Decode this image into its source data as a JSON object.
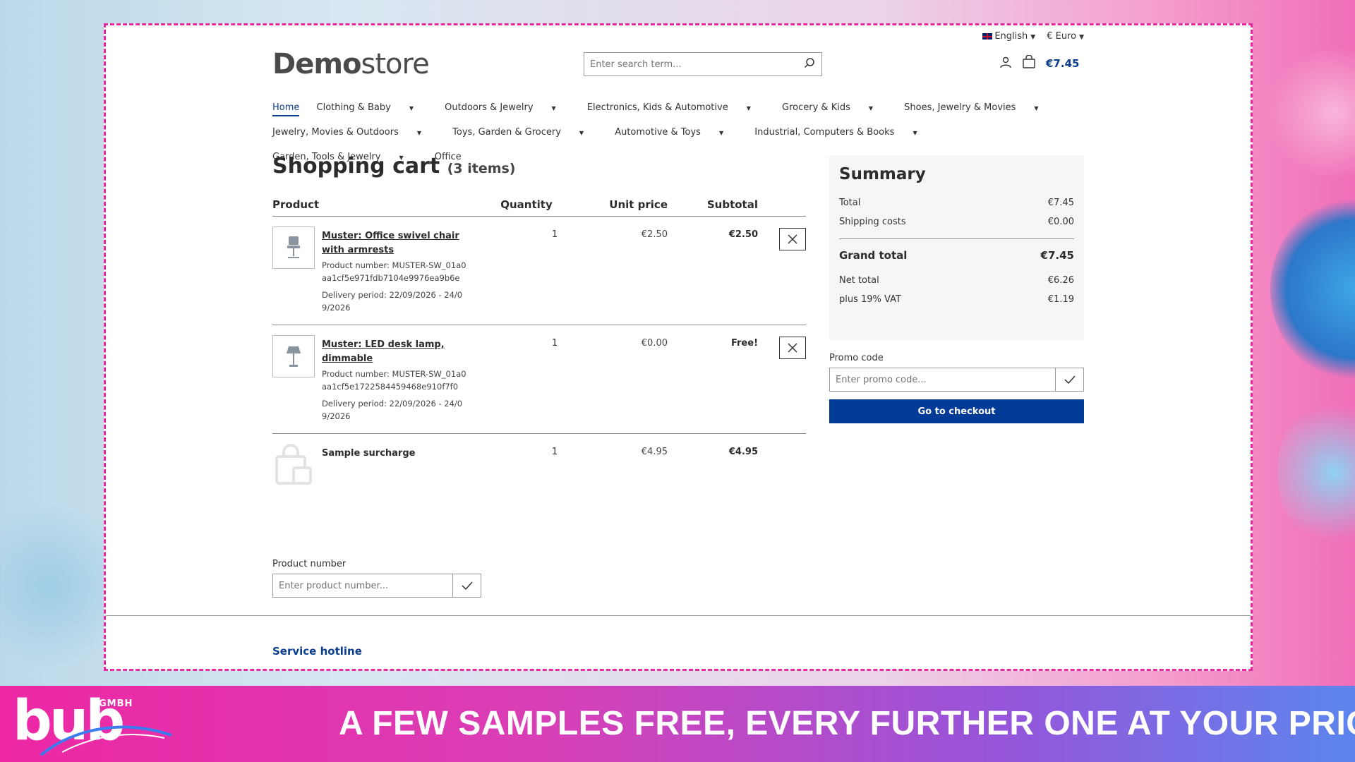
{
  "colors": {
    "accent": "#0b3d91",
    "checkout": "#003b97",
    "border_dash": "#e8289f"
  },
  "topbar": {
    "language": "English",
    "currency": "€ Euro"
  },
  "header": {
    "brand_bold": "Demo",
    "brand_light": "store",
    "search_placeholder": "Enter search term...",
    "cart_total": "€7.45"
  },
  "nav": {
    "items": [
      "Home",
      "Clothing & Baby",
      "Outdoors & Jewelry",
      "Electronics, Kids & Automotive",
      "Grocery & Kids",
      "Shoes, Jewelry & Movies",
      "Jewelry, Movies & Outdoors",
      "Toys, Garden & Grocery",
      "Automotive & Toys",
      "Industrial, Computers & Books",
      "Garden, Tools & Jewelry",
      "Office"
    ]
  },
  "cart": {
    "title": "Shopping cart",
    "count": "(3 items)",
    "columns": {
      "product": "Product",
      "quantity": "Quantity",
      "unit_price": "Unit price",
      "subtotal": "Subtotal"
    },
    "rows": [
      {
        "name": "Muster: Office swivel chair with armrests",
        "number": "Product number: MUSTER-SW_01a0aa1cf5e971fdb7104e9976ea9b6e",
        "delivery": "Delivery period: 22/09/2026 - 24/09/2026",
        "qty": "1",
        "unit": "€2.50",
        "subtotal": "€2.50"
      },
      {
        "name": "Muster: LED desk lamp, dimmable",
        "number": "Product number: MUSTER-SW_01a0aa1cf5e1722584459468e910f7f0",
        "delivery": "Delivery period: 22/09/2026 - 24/09/2026",
        "qty": "1",
        "unit": "€0.00",
        "subtotal": "Free!"
      },
      {
        "name": "Sample surcharge",
        "qty": "1",
        "unit": "€4.95",
        "subtotal": "€4.95"
      }
    ],
    "product_number_label": "Product number",
    "product_number_placeholder": "Enter product number..."
  },
  "summary": {
    "title": "Summary",
    "total_label": "Total",
    "total": "€7.45",
    "shipping_label": "Shipping costs",
    "shipping": "€0.00",
    "grand_label": "Grand total",
    "grand": "€7.45",
    "net_label": "Net total",
    "net": "€6.26",
    "vat_label": "plus 19% VAT",
    "vat": "€1.19",
    "promo_label": "Promo code",
    "promo_placeholder": "Enter promo code...",
    "checkout": "Go to checkout"
  },
  "footer": {
    "hotline": "Service hotline"
  },
  "banner": {
    "logo": "bub",
    "logo_sub": "GMBH",
    "text": "A FEW SAMPLES FREE, EVERY FURTHER ONE AT YOUR PRICE"
  }
}
